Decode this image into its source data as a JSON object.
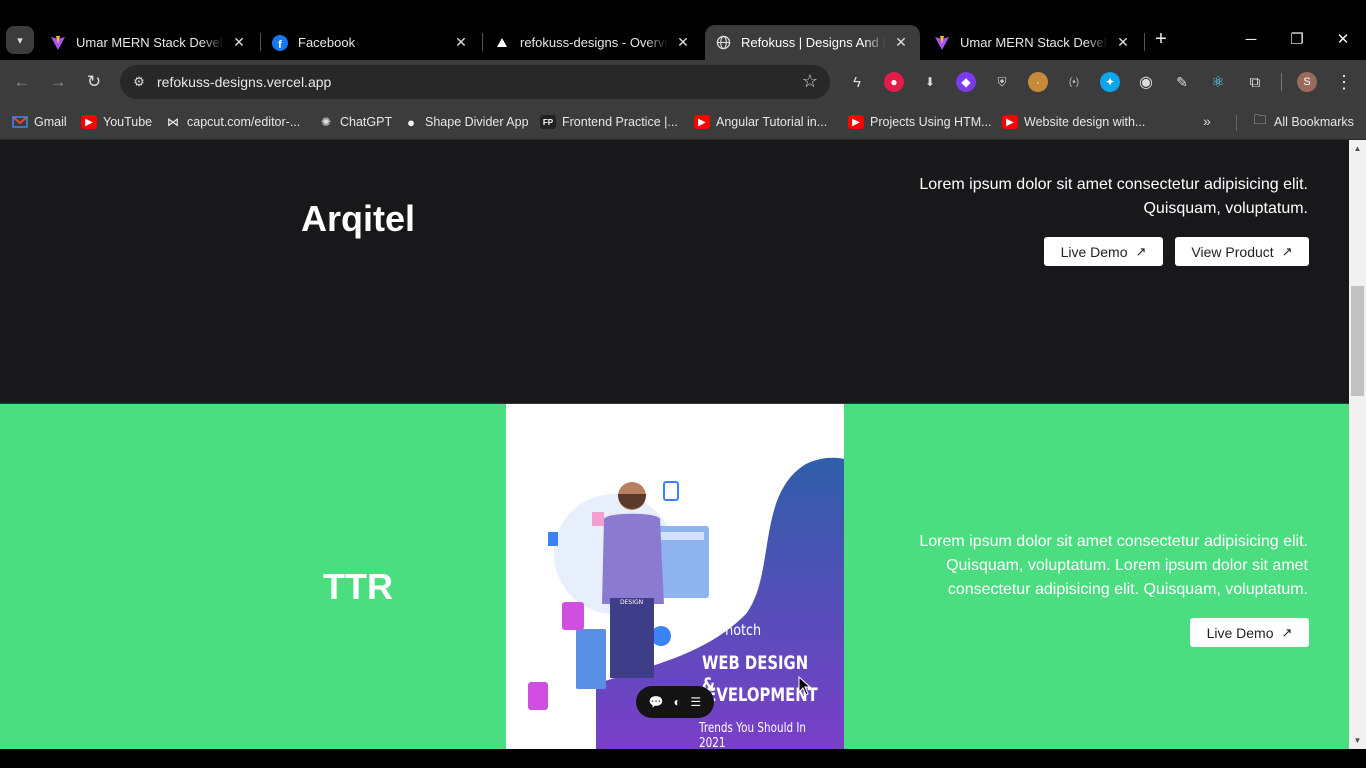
{
  "browser": {
    "tabs": [
      {
        "title": "Umar MERN Stack Developer",
        "icon": "vite-icon",
        "active": false
      },
      {
        "title": "Facebook",
        "icon": "facebook-icon",
        "active": false
      },
      {
        "title": "refokuss-designs - Overview",
        "icon": "vercel-icon",
        "active": false
      },
      {
        "title": "Refokuss | Designs And Development",
        "icon": "globe-icon",
        "active": true
      },
      {
        "title": "Umar MERN Stack Developer",
        "icon": "vite-icon",
        "active": false
      }
    ],
    "url": "refokuss-designs.vercel.app",
    "bookmarks": [
      {
        "label": "Gmail",
        "icon": "gmail-icon"
      },
      {
        "label": "YouTube",
        "icon": "youtube-icon"
      },
      {
        "label": "capcut.com/editor-...",
        "icon": "capcut-icon"
      },
      {
        "label": "ChatGPT",
        "icon": "chatgpt-icon"
      },
      {
        "label": "Shape Divider App",
        "icon": "shape-divider-icon"
      },
      {
        "label": "Frontend Practice |...",
        "icon": "fp-icon"
      },
      {
        "label": "Angular Tutorial in...",
        "icon": "youtube-icon"
      },
      {
        "label": "Projects Using HTM...",
        "icon": "youtube-icon"
      },
      {
        "label": "Website design with...",
        "icon": "youtube-icon"
      }
    ],
    "all_bookmarks_label": "All Bookmarks",
    "profile_initial": "S"
  },
  "projects": [
    {
      "name": "Arqitel",
      "description": "Lorem ipsum dolor sit amet consectetur adipisicing elit. Quisquam, voluptatum.",
      "live_demo_label": "Live Demo",
      "view_product_label": "View Product"
    },
    {
      "name": "TTR",
      "description": "Lorem ipsum dolor sit amet consectetur adipisicing elit. Quisquam, voluptatum. Lorem ipsum dolor sit amet consectetur adipisicing elit. Quisquam, voluptatum.",
      "live_demo_label": "Live Demo",
      "image": {
        "line1": "Top-notch",
        "line2": "WEB DESIGN &",
        "line3": "DEVELOPMENT",
        "line4": "Trends You Should In 2021",
        "badge": "DESIGN"
      }
    }
  ],
  "colors": {
    "dark_section": "#18181b",
    "green_section": "#4ade80",
    "accent_purple": "#6b4bb8"
  }
}
